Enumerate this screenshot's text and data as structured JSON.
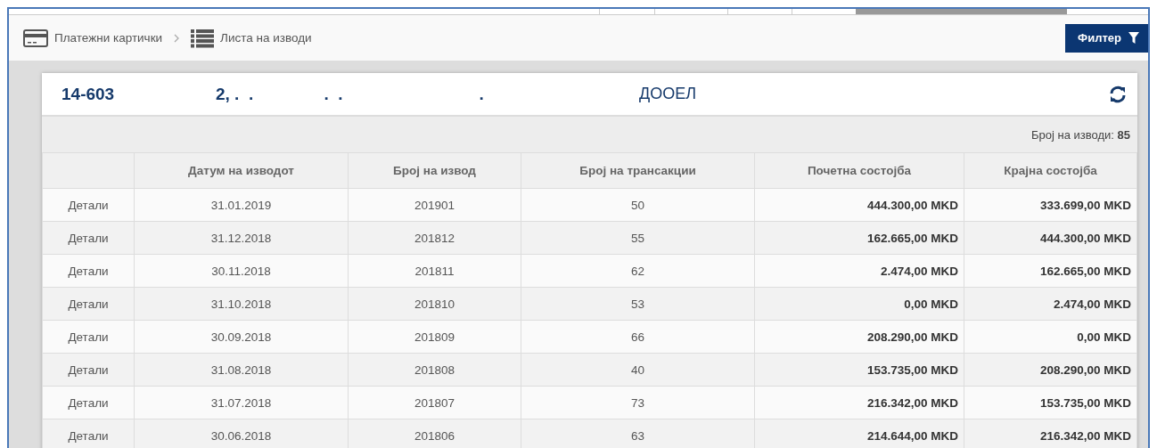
{
  "breadcrumb": [
    {
      "label": "Платежни картички",
      "kind": "card"
    },
    {
      "label": "Листа на изводи",
      "kind": "list"
    }
  ],
  "filter_button": {
    "label": "Филтер"
  },
  "account": {
    "number": "14-603",
    "name": "2, .  .               .  .                             .",
    "suffix": "ДООЕЛ"
  },
  "count": {
    "label": "Број на изводи:",
    "value": "85"
  },
  "table": {
    "columns": [
      "",
      "Датум на изводот",
      "Број на извод",
      "Број на трансакции",
      "Почетна состојба",
      "Крајна состојба"
    ],
    "rows": [
      [
        "Детали",
        "31.01.2019",
        "201901",
        "50",
        "444.300,00 MKD",
        "333.699,00 MKD"
      ],
      [
        "Детали",
        "31.12.2018",
        "201812",
        "55",
        "162.665,00 MKD",
        "444.300,00 MKD"
      ],
      [
        "Детали",
        "30.11.2018",
        "201811",
        "62",
        "2.474,00 MKD",
        "162.665,00 MKD"
      ],
      [
        "Детали",
        "31.10.2018",
        "201810",
        "53",
        "0,00 MKD",
        "2.474,00 MKD"
      ],
      [
        "Детали",
        "30.09.2018",
        "201809",
        "66",
        "208.290,00 MKD",
        "0,00 MKD"
      ],
      [
        "Детали",
        "31.08.2018",
        "201808",
        "40",
        "153.735,00 MKD",
        "208.290,00 MKD"
      ],
      [
        "Детали",
        "31.07.2018",
        "201807",
        "73",
        "216.342,00 MKD",
        "153.735,00 MKD"
      ],
      [
        "Детали",
        "30.06.2018",
        "201806",
        "63",
        "214.644,00 MKD",
        "216.342,00 MKD"
      ]
    ]
  }
}
